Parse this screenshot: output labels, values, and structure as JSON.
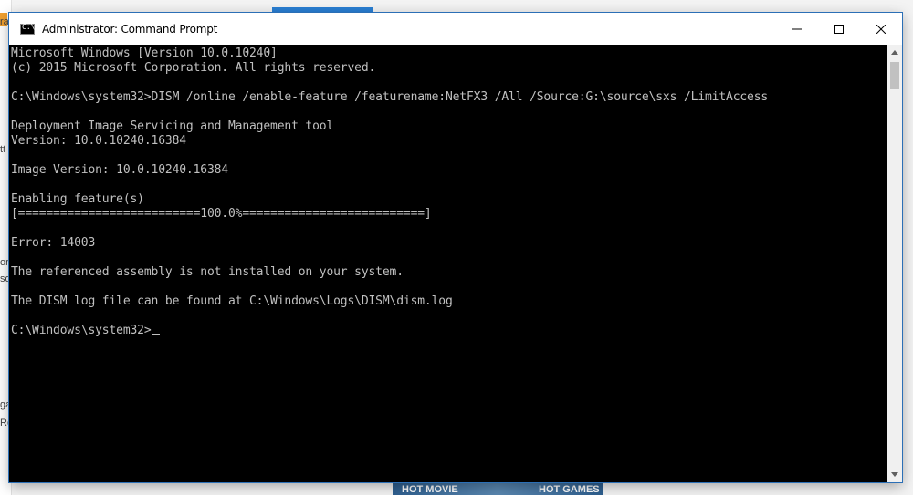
{
  "window": {
    "title": "Administrator: Command Prompt"
  },
  "console": {
    "lines": [
      "Microsoft Windows [Version 10.0.10240]",
      "(c) 2015 Microsoft Corporation. All rights reserved.",
      "",
      "C:\\Windows\\system32>DISM /online /enable-feature /featurename:NetFX3 /All /Source:G:\\source\\sxs /LimitAccess",
      "",
      "Deployment Image Servicing and Management tool",
      "Version: 10.0.10240.16384",
      "",
      "Image Version: 10.0.10240.16384",
      "",
      "Enabling feature(s)",
      "[==========================100.0%==========================]",
      "",
      "Error: 14003",
      "",
      "The referenced assembly is not installed on your system.",
      "",
      "The DISM log file can be found at C:\\Windows\\Logs\\DISM\\dism.log",
      "",
      "C:\\Windows\\system32>"
    ]
  },
  "background": {
    "game_labels": [
      "HOT MOVIE",
      "HOT GAMES"
    ],
    "left_fragments": [
      "ra",
      "tt",
      "or",
      "so",
      "ga",
      "Ro"
    ]
  },
  "colors": {
    "console_bg": "#000000",
    "console_text": "#c0c0c0",
    "titlebar_bg": "#ffffff",
    "window_border": "#2b6fb6"
  },
  "icons": {
    "title": "cmd-icon",
    "minimize": "minimize-icon",
    "maximize": "maximize-icon",
    "close": "close-icon",
    "scroll_up": "chevron-up-icon",
    "scroll_down": "chevron-down-icon"
  }
}
